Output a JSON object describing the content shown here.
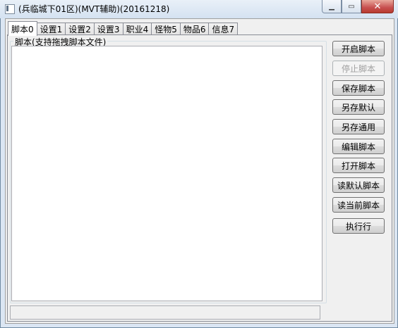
{
  "window": {
    "title": "(兵临城下01区)(MVT辅助)(20161218)"
  },
  "tabs": [
    {
      "label": "脚本0",
      "active": true
    },
    {
      "label": "设置1",
      "active": false
    },
    {
      "label": "设置2",
      "active": false
    },
    {
      "label": "设置3",
      "active": false
    },
    {
      "label": "职业4",
      "active": false
    },
    {
      "label": "怪物5",
      "active": false
    },
    {
      "label": "物品6",
      "active": false
    },
    {
      "label": "信息7",
      "active": false
    }
  ],
  "script_group": {
    "label": "脚本(支持拖拽脚本文件)",
    "content": ""
  },
  "status": "",
  "buttons": [
    {
      "label": "开启脚本",
      "enabled": true
    },
    {
      "label": "停止脚本",
      "enabled": false
    },
    {
      "label": "保存脚本",
      "enabled": true
    },
    {
      "label": "另存默认",
      "enabled": true
    },
    {
      "label": "另存通用",
      "enabled": true
    },
    {
      "label": "编辑脚本",
      "enabled": true
    },
    {
      "label": "打开脚本",
      "enabled": true
    },
    {
      "label": "读默认脚本",
      "enabled": true
    },
    {
      "label": "读当前脚本",
      "enabled": true
    },
    {
      "label": "执行行",
      "enabled": true
    }
  ]
}
